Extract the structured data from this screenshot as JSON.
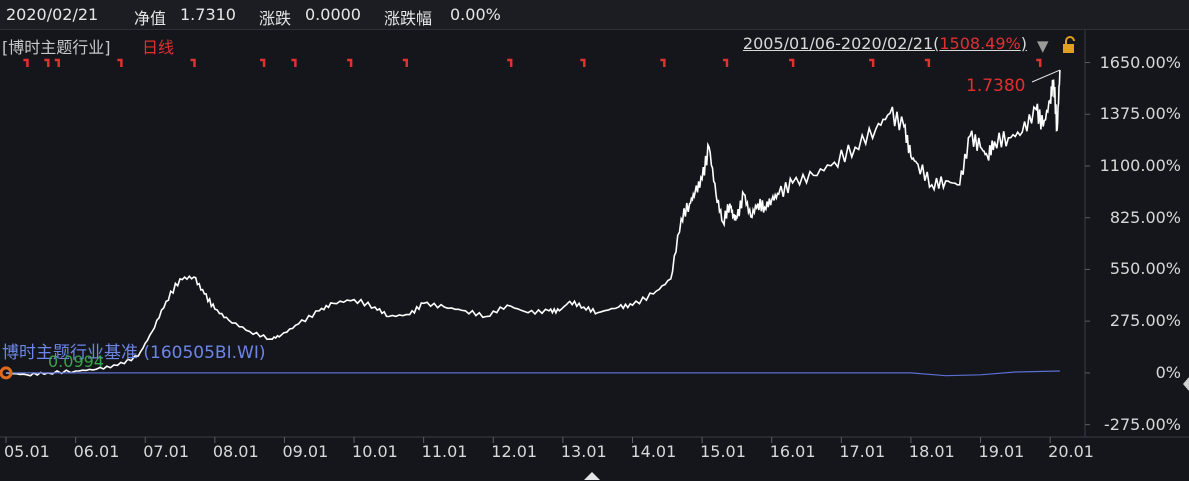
{
  "header": {
    "date": "2020/02/21",
    "nav_label": "净值",
    "nav_value": "1.7310",
    "change_label": "涨跌",
    "change_value": "0.0000",
    "change_pct_label": "涨跌幅",
    "change_pct_value": "0.00%"
  },
  "legend": {
    "fund_name": "[博时主题行业]",
    "line_type": "日线",
    "range_text": "2005/01/06-2020/02/21",
    "range_open": "(",
    "range_pct": "1508.49%",
    "range_close": ")"
  },
  "benchmark": {
    "label": "博时主题行业基准 (160505BI.WI)",
    "value": "0.0994"
  },
  "last_value": "1.7380",
  "colors": {
    "background": "#14161b",
    "fund_line": "#ffffff",
    "benchmark_line": "#5a6fd0",
    "red": "#e03030",
    "green": "#3aa54a"
  },
  "chart_data": {
    "type": "line",
    "x_ticks": [
      "05.01",
      "06.01",
      "07.01",
      "08.01",
      "09.01",
      "10.01",
      "11.01",
      "12.01",
      "13.01",
      "14.01",
      "15.01",
      "16.01",
      "17.01",
      "18.01",
      "19.01",
      "20.01"
    ],
    "y_ticks": [
      "1650.00%",
      "1375.00%",
      "1100.00%",
      "825.00%",
      "550.00%",
      "275.00%",
      "0%",
      "-275.00%"
    ],
    "ylim": [
      -330,
      1690
    ],
    "series": [
      {
        "name": "博时主题行业",
        "x": [
          2005.0,
          2005.3,
          2005.6,
          2006.0,
          2006.3,
          2006.6,
          2006.9,
          2007.1,
          2007.3,
          2007.5,
          2007.7,
          2007.85,
          2008.0,
          2008.2,
          2008.5,
          2008.8,
          2008.95,
          2009.2,
          2009.5,
          2009.7,
          2010.0,
          2010.3,
          2010.5,
          2010.8,
          2011.0,
          2011.3,
          2011.6,
          2011.9,
          2012.2,
          2012.5,
          2012.8,
          2012.95,
          2013.1,
          2013.3,
          2013.5,
          2013.8,
          2014.0,
          2014.3,
          2014.55,
          2014.7,
          2014.82,
          2014.9,
          2015.0,
          2015.1,
          2015.2,
          2015.3,
          2015.4,
          2015.45,
          2015.5,
          2015.6,
          2015.7,
          2015.8,
          2015.9,
          2016.0,
          2016.1,
          2016.3,
          2016.6,
          2016.9,
          2017.2,
          2017.5,
          2017.7,
          2017.9,
          2018.0,
          2018.1,
          2018.3,
          2018.5,
          2018.7,
          2018.85,
          2019.0,
          2019.1,
          2019.2,
          2019.4,
          2019.6,
          2019.8,
          2019.9,
          2020.0,
          2020.05,
          2020.1,
          2020.14
        ],
        "y": [
          0,
          -10,
          0,
          10,
          20,
          40,
          90,
          220,
          380,
          500,
          510,
          420,
          340,
          280,
          220,
          180,
          200,
          260,
          330,
          370,
          390,
          350,
          300,
          310,
          370,
          350,
          330,
          300,
          360,
          320,
          330,
          330,
          380,
          350,
          320,
          350,
          360,
          420,
          500,
          820,
          900,
          960,
          1030,
          1200,
          950,
          800,
          900,
          830,
          820,
          950,
          830,
          900,
          880,
          920,
          950,
          1010,
          1050,
          1120,
          1200,
          1300,
          1380,
          1310,
          1150,
          1110,
          1000,
          1020,
          1000,
          1260,
          1200,
          1150,
          1230,
          1250,
          1280,
          1400,
          1310,
          1450,
          1560,
          1290,
          1610
        ]
      },
      {
        "name": "博时主题行业基准 (160505BI.WI)",
        "x": [
          2005.0,
          2007.0,
          2010.0,
          2013.0,
          2015.0,
          2017.0,
          2018.0,
          2018.5,
          2019.0,
          2019.5,
          2020.14
        ],
        "y": [
          0,
          0,
          0,
          0,
          0,
          0,
          0,
          -15,
          -10,
          5,
          10
        ]
      }
    ]
  }
}
